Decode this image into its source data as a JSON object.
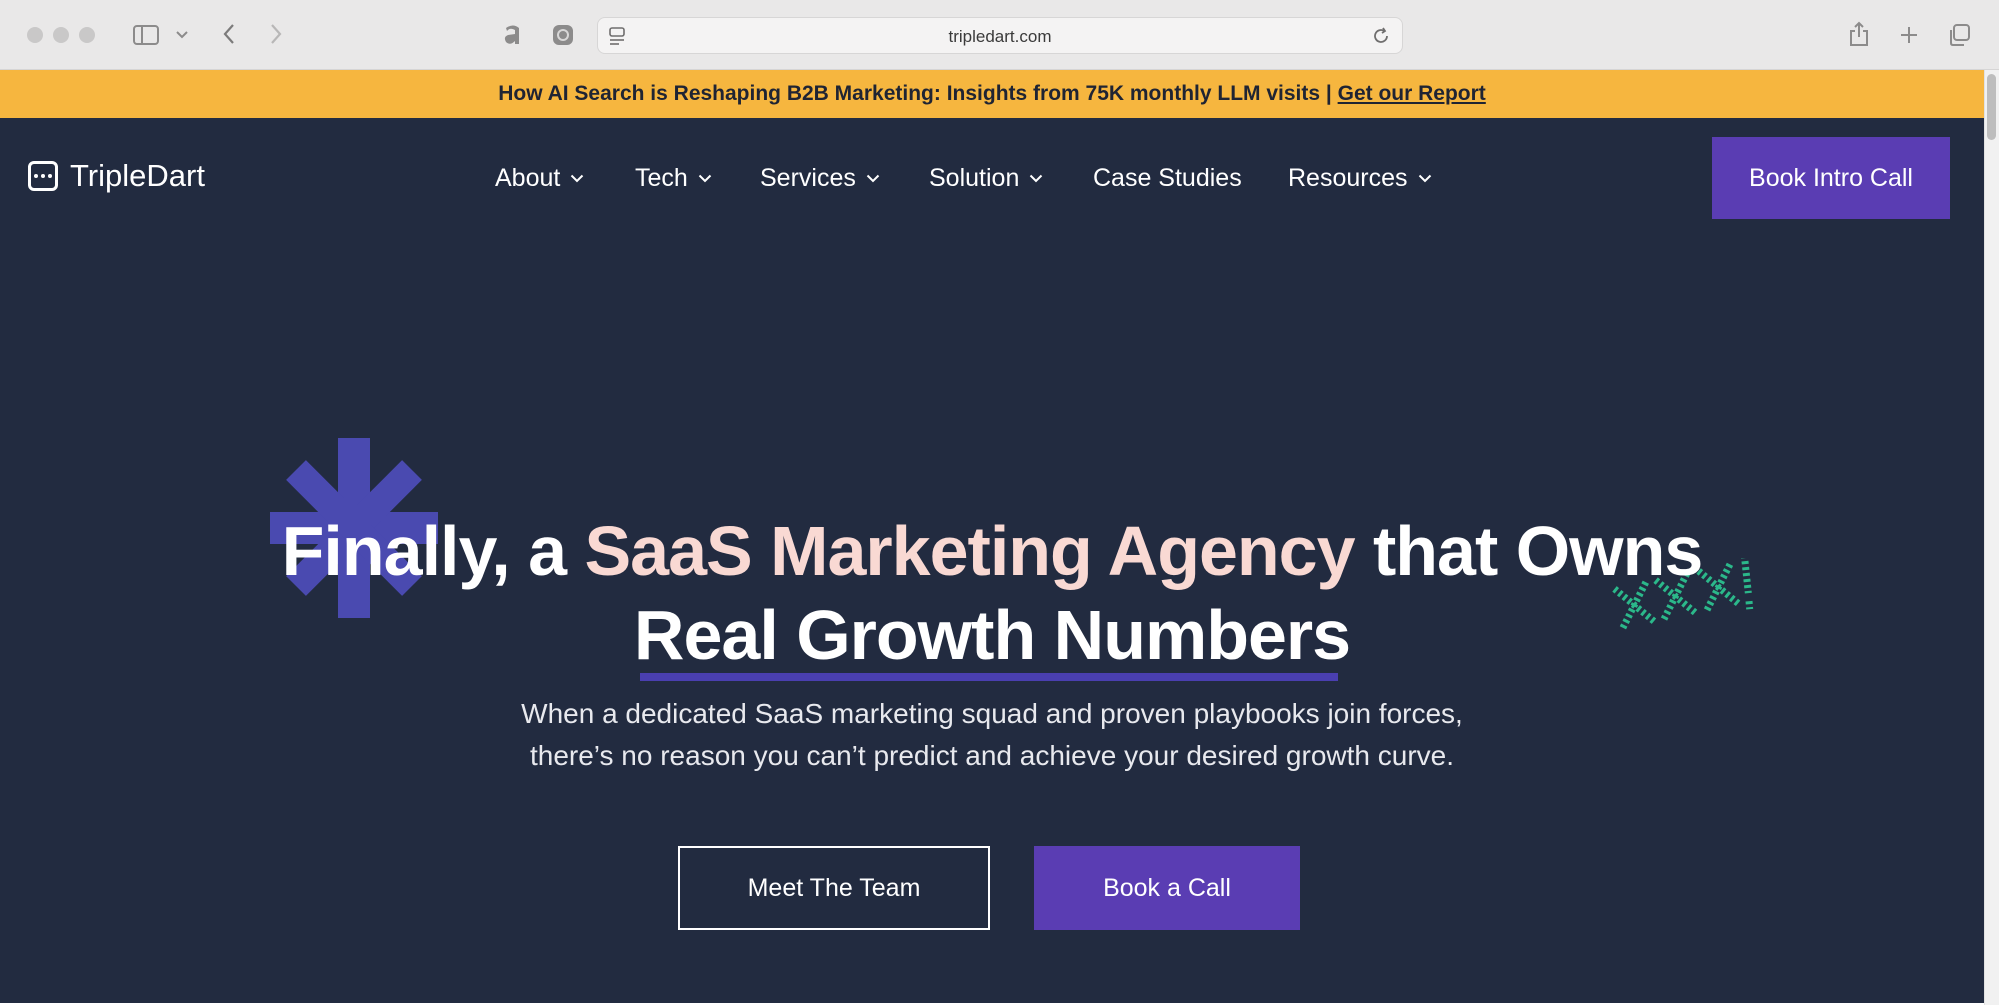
{
  "browser": {
    "url": "tripledart.com"
  },
  "announcement": {
    "text": "How AI Search is Reshaping B2B Marketing: Insights from 75K monthly LLM visits |",
    "link_label": "Get our Report"
  },
  "header": {
    "logo_text": "TripleDart",
    "nav": [
      {
        "label": "About",
        "has_dropdown": true
      },
      {
        "label": "Tech",
        "has_dropdown": true
      },
      {
        "label": "Services",
        "has_dropdown": true
      },
      {
        "label": "Solution",
        "has_dropdown": true
      },
      {
        "label": "Case Studies",
        "has_dropdown": false
      },
      {
        "label": "Resources",
        "has_dropdown": true
      }
    ],
    "cta_label": "Book Intro Call"
  },
  "hero": {
    "headline_part1": "Finally, a ",
    "headline_accent": "SaaS Marketing Agency",
    "headline_part2": " that Owns",
    "headline_line2": "Real Growth Numbers",
    "sub_line1": "When a dedicated SaaS marketing squad and proven playbooks join forces,",
    "sub_line2": "there’s no reason you can’t predict and achieve your desired growth curve.",
    "btn_team_label": "Meet The Team",
    "btn_call_label": "Book a Call"
  },
  "colors": {
    "announce_bg": "#f6b63f",
    "site_bg": "#222b40",
    "brand_purple": "#5a3db3",
    "accent_pink": "#f9d9d3",
    "doodle_green": "#2bb88a"
  },
  "icons": {
    "sidebar": "sidebar-icon",
    "back": "chevron-left-icon",
    "forward": "chevron-right-icon",
    "share": "share-icon",
    "new_tab": "plus-icon",
    "tabs": "tabs-icon",
    "reload": "reload-icon",
    "chevron": "chevron-down-icon"
  }
}
